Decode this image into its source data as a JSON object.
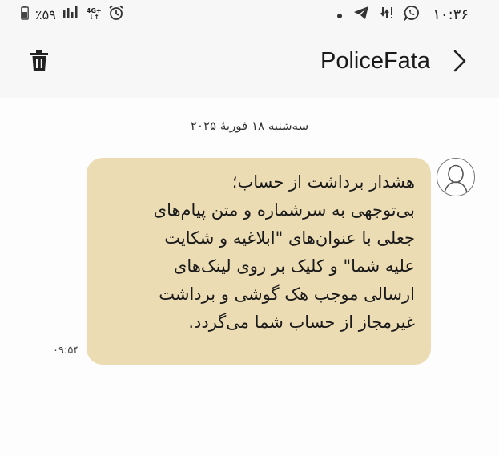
{
  "status_bar": {
    "time": "۱۰:۳۶",
    "battery_percent": "٪۵۹",
    "network": "4G+",
    "icons": [
      "dot-icon",
      "telegram-icon",
      "data-alert-icon",
      "whatsapp-icon",
      "alarm-icon",
      "signal-icon",
      "battery-icon"
    ]
  },
  "header": {
    "contact_name": "PoliceFata",
    "back_icon": "chevron-right-icon",
    "delete_icon": "trash-icon"
  },
  "conversation": {
    "date": "سه‌شنبه ۱۸ فوریهٔ ۲۰۲۵",
    "message": {
      "lines": [
        "هشدار برداشت از حساب؛",
        "بی‌توجهی به سرشماره و متن پیام‌های",
        "جعلی با عنوان‌های \"ابلاغیه و شکایت",
        "علیه شما\" و کلیک بر روی لینک‌های",
        "ارسالی موجب هک گوشی و برداشت",
        "غیرمجاز از حساب شما می‌گردد."
      ],
      "time": "۰۹:۵۴"
    }
  },
  "colors": {
    "bubble": "#ecdcb4",
    "background": "#fdfdfd",
    "header": "#f7f7f7"
  }
}
